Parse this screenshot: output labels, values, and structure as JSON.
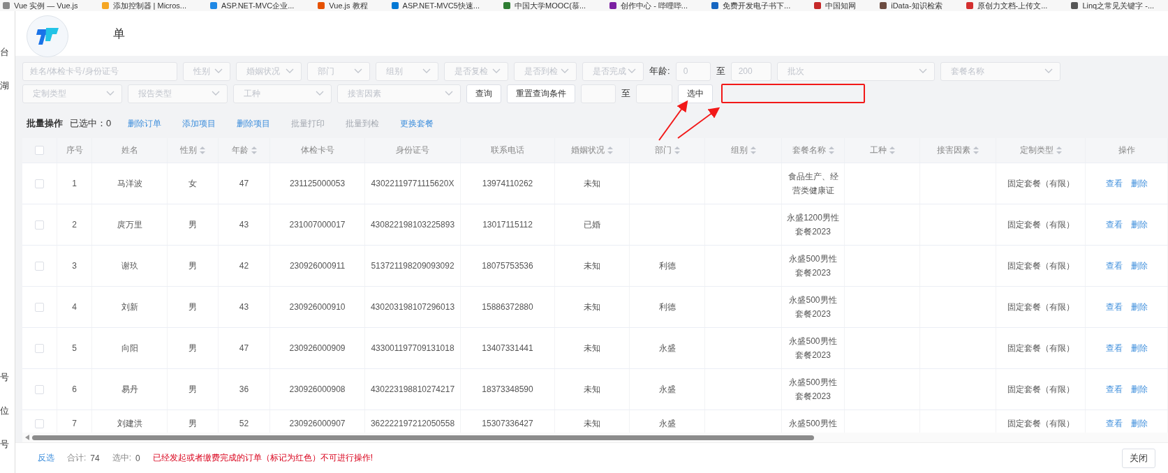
{
  "bookmarks": [
    "Vue 实例 — Vue.js",
    "添加控制器 | Micros...",
    "ASP.NET-MVC企业...",
    "Vue.js 教程",
    "ASP.NET-MVC5快速...",
    "中国大学MOOC(慕...",
    "创作中心 - 哔哩哔...",
    "免费开发电子书下...",
    "中国知网",
    "iData-知识检索",
    "原创力文档-上传文...",
    "Linq之常见关键字 -..."
  ],
  "background_fragments": [
    "台",
    "湖",
    "号",
    "位",
    "号"
  ],
  "dialog": {
    "title": "单"
  },
  "filters": [
    [
      {
        "kind": "input",
        "placeholder": "姓名/体检卡号/身份证号"
      },
      {
        "kind": "select",
        "placeholder": "性别"
      },
      {
        "kind": "select",
        "placeholder": "婚姻状况"
      },
      {
        "kind": "select",
        "placeholder": "部门"
      },
      {
        "kind": "select",
        "placeholder": "组别"
      },
      {
        "kind": "select",
        "placeholder": "是否复检"
      },
      {
        "kind": "select",
        "placeholder": "是否到检"
      },
      {
        "kind": "select",
        "placeholder": "是否完成"
      },
      {
        "kind": "label",
        "text": "年龄:"
      },
      {
        "kind": "input",
        "placeholder": "0"
      },
      {
        "kind": "label",
        "text": "至"
      },
      {
        "kind": "input",
        "placeholder": "200"
      },
      {
        "kind": "select",
        "placeholder": "批次"
      },
      {
        "kind": "select",
        "placeholder": "套餐名称"
      }
    ],
    [
      {
        "kind": "select",
        "placeholder": "定制类型"
      },
      {
        "kind": "select",
        "placeholder": "报告类型"
      },
      {
        "kind": "select",
        "placeholder": "工种"
      },
      {
        "kind": "select",
        "placeholder": "接害因素"
      },
      {
        "kind": "button",
        "text": "查询"
      },
      {
        "kind": "button",
        "text": "重置查询条件"
      },
      {
        "kind": "input"
      },
      {
        "kind": "label",
        "text": "至"
      },
      {
        "kind": "input"
      },
      {
        "kind": "button",
        "text": "选中"
      },
      {
        "kind": "highlight"
      }
    ]
  ],
  "batch": {
    "title": "批量操作",
    "selected_label": "已选中：",
    "selected_count": "0",
    "actions": [
      {
        "label": "删除订单",
        "disabled": false
      },
      {
        "label": "添加项目",
        "disabled": false
      },
      {
        "label": "删除项目",
        "disabled": false
      },
      {
        "label": "批量打印",
        "disabled": true
      },
      {
        "label": "批量到检",
        "disabled": true
      },
      {
        "label": "更换套餐",
        "disabled": false
      }
    ]
  },
  "table": {
    "select_all": false,
    "columns": [
      {
        "label": "序号",
        "sortable": false
      },
      {
        "label": "姓名",
        "sortable": false
      },
      {
        "label": "性别",
        "sortable": true
      },
      {
        "label": "年龄",
        "sortable": true
      },
      {
        "label": "体检卡号",
        "sortable": false
      },
      {
        "label": "身份证号",
        "sortable": false
      },
      {
        "label": "联系电话",
        "sortable": false
      },
      {
        "label": "婚姻状况",
        "sortable": true
      },
      {
        "label": "部门",
        "sortable": true
      },
      {
        "label": "组别",
        "sortable": true
      },
      {
        "label": "套餐名称",
        "sortable": true
      },
      {
        "label": "工种",
        "sortable": true
      },
      {
        "label": "接害因素",
        "sortable": true
      },
      {
        "label": "定制类型",
        "sortable": true
      },
      {
        "label": "操作",
        "sortable": false
      }
    ],
    "rows": [
      {
        "checked": false,
        "cells": [
          "1",
          "马洋波",
          "女",
          "47",
          "231125000053",
          "43022119771115620X",
          "13974110262",
          "未知",
          null,
          null,
          "食品生产、经营类健康证",
          null,
          null,
          "固定套餐（有限）"
        ],
        "actions": [
          "查看",
          "删除"
        ]
      },
      {
        "checked": false,
        "cells": [
          "2",
          "庹万里",
          "男",
          "43",
          "231007000017",
          "430822198103225893",
          "13017115112",
          "已婚",
          null,
          null,
          "永盛1200男性套餐2023",
          null,
          null,
          "固定套餐（有限）"
        ],
        "actions": [
          "查看",
          "删除"
        ]
      },
      {
        "checked": false,
        "cells": [
          "3",
          "谢玖",
          "男",
          "42",
          "230926000911",
          "513721198209093092",
          "18075753536",
          "未知",
          "利德",
          null,
          "永盛500男性套餐2023",
          null,
          null,
          "固定套餐（有限）"
        ],
        "actions": [
          "查看",
          "删除"
        ]
      },
      {
        "checked": false,
        "cells": [
          "4",
          "刘新",
          "男",
          "43",
          "230926000910",
          "430203198107296013",
          "15886372880",
          "未知",
          "利德",
          null,
          "永盛500男性套餐2023",
          null,
          null,
          "固定套餐（有限）"
        ],
        "actions": [
          "查看",
          "删除"
        ]
      },
      {
        "checked": false,
        "cells": [
          "5",
          "向阳",
          "男",
          "47",
          "230926000909",
          "433001197709131018",
          "13407331441",
          "未知",
          "永盛",
          null,
          "永盛500男性套餐2023",
          null,
          null,
          "固定套餐（有限）"
        ],
        "actions": [
          "查看",
          "删除"
        ]
      },
      {
        "checked": false,
        "cells": [
          "6",
          "易丹",
          "男",
          "36",
          "230926000908",
          "430223198810274217",
          "18373348590",
          "未知",
          "永盛",
          null,
          "永盛500男性套餐2023",
          null,
          null,
          "固定套餐（有限）"
        ],
        "actions": [
          "查看",
          "删除"
        ]
      },
      {
        "checked": false,
        "cells": [
          "7",
          "刘建洪",
          "男",
          "52",
          "230926000907",
          "362222197212050558",
          "15307336427",
          "未知",
          "永盛",
          null,
          "永盛500男性",
          null,
          null,
          "固定套餐（有限）"
        ],
        "actions": [
          "查看",
          "删除"
        ]
      }
    ]
  },
  "footer": {
    "invert_link": "反选",
    "total_label": "合计:",
    "total": "74",
    "selected_label": "选中:",
    "selected": "0",
    "warning": "已经发起或者缴费完成的订单（标记为红色）不可进行操作!",
    "close_button": "关闭"
  }
}
